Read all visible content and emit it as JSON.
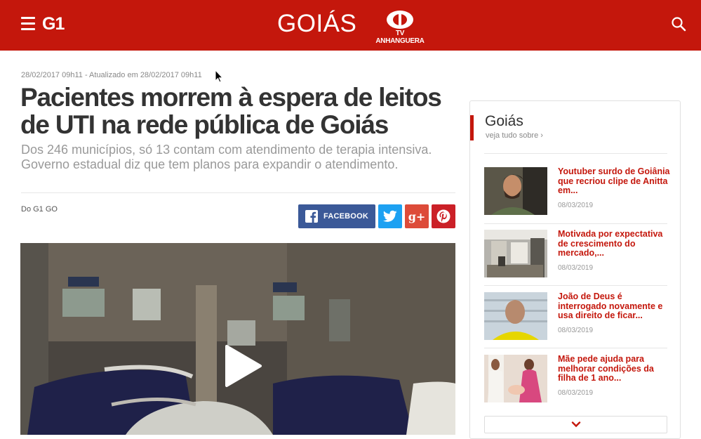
{
  "header": {
    "brand": "G1",
    "section": "GOIÁS",
    "tv_brand": "TV ANHANGUERA",
    "menu_icon": "hamburger-icon",
    "search_icon": "search-icon",
    "brand_color": "#c4170c"
  },
  "article": {
    "timestamp": "28/02/2017 09h11 - Atualizado em 28/02/2017 09h11",
    "headline": "Pacientes morrem à espera de leitos de UTI na rede pública de Goiás",
    "subtitle": "Dos 246 municípios, só 13 contam com atendimento de terapia intensiva. Governo estadual diz que tem planos para expandir o atendimento.",
    "byline": "Do G1 GO",
    "share": {
      "facebook_label": "FACEBOOK",
      "twitter_icon": "twitter-icon",
      "googleplus_label": "g+",
      "pinterest_icon": "pinterest-icon"
    },
    "video": {
      "play_icon": "play-icon"
    }
  },
  "sidebar": {
    "title": "Goiás",
    "see_all": "veja tudo sobre ›",
    "items": [
      {
        "title": "Youtuber surdo de Goiânia que recriou clipe de Anitta em...",
        "date": "08/03/2019"
      },
      {
        "title": "Motivada por expectativa de crescimento do mercado,...",
        "date": "08/03/2019"
      },
      {
        "title": "João de Deus é interrogado novamente e usa direito de ficar...",
        "date": "08/03/2019"
      },
      {
        "title": "Mãe pede ajuda para melhorar condições da filha de 1 ano...",
        "date": "08/03/2019"
      }
    ],
    "more_icon": "chevron-down-icon"
  }
}
